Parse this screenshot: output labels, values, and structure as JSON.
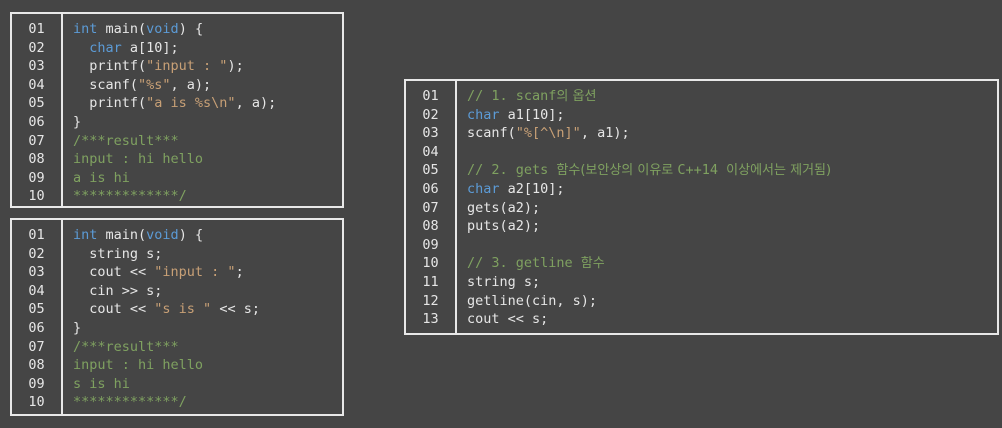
{
  "panels": [
    {
      "id": "p1",
      "line_numbers": [
        "01",
        "02",
        "03",
        "04",
        "05",
        "06",
        "07",
        "08",
        "09",
        "10"
      ],
      "lines": [
        [
          {
            "t": "int",
            "c": "kw"
          },
          {
            "t": " main("
          },
          {
            "t": "void",
            "c": "kw"
          },
          {
            "t": ") {"
          }
        ],
        [
          {
            "t": "  "
          },
          {
            "t": "char",
            "c": "kw"
          },
          {
            "t": " a[10];"
          }
        ],
        [
          {
            "t": "  printf("
          },
          {
            "t": "\"input : \"",
            "c": "str"
          },
          {
            "t": ");"
          }
        ],
        [
          {
            "t": "  scanf("
          },
          {
            "t": "\"%s\"",
            "c": "str"
          },
          {
            "t": ", a);"
          }
        ],
        [
          {
            "t": "  printf("
          },
          {
            "t": "\"a is %s\\n\"",
            "c": "str"
          },
          {
            "t": ", a);"
          }
        ],
        [
          {
            "t": "}"
          }
        ],
        [
          {
            "t": "/***result***",
            "c": "cm"
          }
        ],
        [
          {
            "t": "input : hi hello",
            "c": "cm"
          }
        ],
        [
          {
            "t": "a is hi",
            "c": "cm"
          }
        ],
        [
          {
            "t": "*************/",
            "c": "cm"
          }
        ]
      ]
    },
    {
      "id": "p2",
      "line_numbers": [
        "01",
        "02",
        "03",
        "04",
        "05",
        "06",
        "07",
        "08",
        "09",
        "10"
      ],
      "lines": [
        [
          {
            "t": "int",
            "c": "kw"
          },
          {
            "t": " main("
          },
          {
            "t": "void",
            "c": "kw"
          },
          {
            "t": ") {"
          }
        ],
        [
          {
            "t": "  string s;"
          }
        ],
        [
          {
            "t": "  cout << "
          },
          {
            "t": "\"input : \"",
            "c": "str"
          },
          {
            "t": ";"
          }
        ],
        [
          {
            "t": "  cin >> s;"
          }
        ],
        [
          {
            "t": "  cout << "
          },
          {
            "t": "\"s is \"",
            "c": "str"
          },
          {
            "t": " << s;"
          }
        ],
        [
          {
            "t": "}"
          }
        ],
        [
          {
            "t": "/***result***",
            "c": "cm"
          }
        ],
        [
          {
            "t": "input : hi hello",
            "c": "cm"
          }
        ],
        [
          {
            "t": "s is hi",
            "c": "cm"
          }
        ],
        [
          {
            "t": "*************/",
            "c": "cm"
          }
        ]
      ]
    },
    {
      "id": "p3",
      "line_numbers": [
        "01",
        "02",
        "03",
        "04",
        "05",
        "06",
        "07",
        "08",
        "09",
        "10",
        "11",
        "12",
        "13"
      ],
      "lines": [
        [
          {
            "t": "// 1. scanf",
            "c": "cm"
          },
          {
            "t": "의 옵션",
            "c": "cm-ko"
          }
        ],
        [
          {
            "t": "char",
            "c": "kw"
          },
          {
            "t": " a1[10];"
          }
        ],
        [
          {
            "t": "scanf("
          },
          {
            "t": "\"%[^\\n]\"",
            "c": "str"
          },
          {
            "t": ", a1);"
          }
        ],
        [],
        [
          {
            "t": "// 2. gets ",
            "c": "cm"
          },
          {
            "t": "함수(보안상의 이유로 ",
            "c": "cm-ko"
          },
          {
            "t": "C++14 ",
            "c": "cm"
          },
          {
            "t": "이상에서는 제거됨)",
            "c": "cm-ko"
          }
        ],
        [
          {
            "t": "char",
            "c": "kw"
          },
          {
            "t": " a2[10];"
          }
        ],
        [
          {
            "t": "gets(a2);"
          }
        ],
        [
          {
            "t": "puts(a2);"
          }
        ],
        [],
        [
          {
            "t": "// 3. getline ",
            "c": "cm"
          },
          {
            "t": "함수",
            "c": "cm-ko"
          }
        ],
        [
          {
            "t": "string s;"
          }
        ],
        [
          {
            "t": "getline(cin, s);"
          }
        ],
        [
          {
            "t": "cout << s;"
          }
        ]
      ]
    }
  ],
  "colors": {
    "background": "#454545",
    "border": "#e8e8e8",
    "text": "#e6e6e6",
    "keyword": "#5c9bd6",
    "string": "#c8a076",
    "comment": "#7fa160"
  }
}
